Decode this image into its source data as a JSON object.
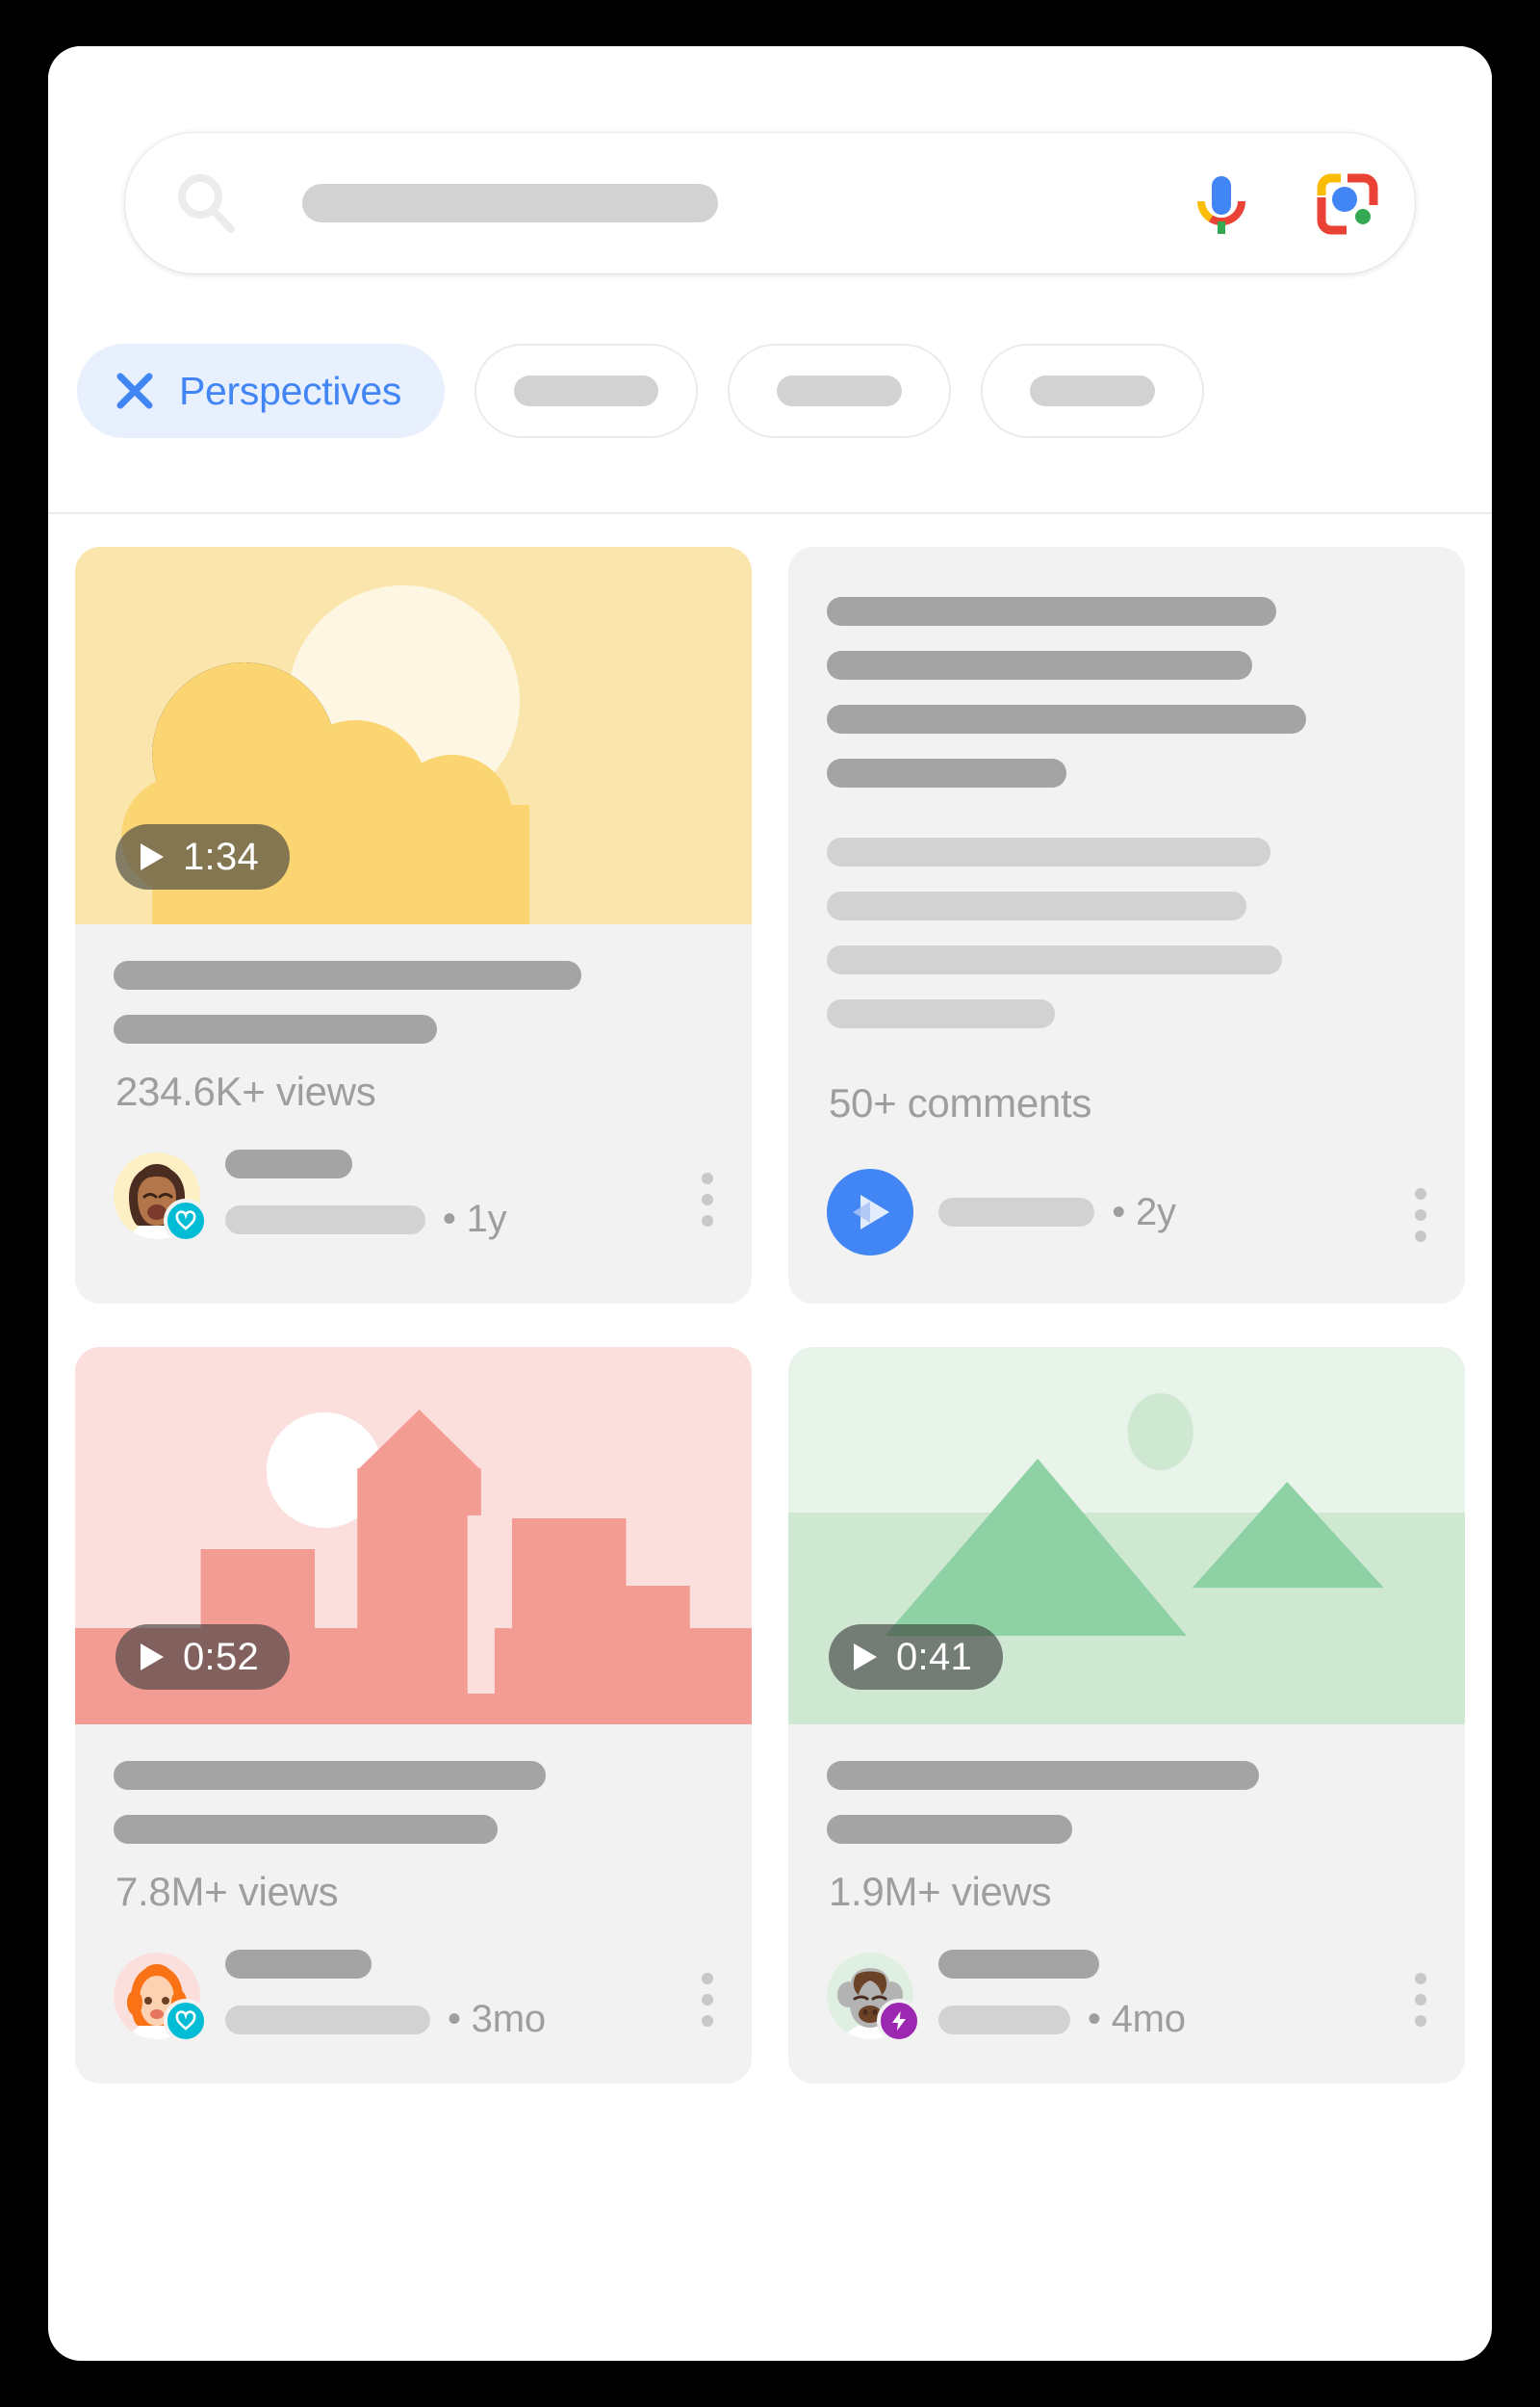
{
  "search": {
    "placeholder_visible": false,
    "icons": {
      "search": "search-icon",
      "mic": "microphone-icon",
      "lens": "google-lens-icon"
    }
  },
  "filters": {
    "chips": [
      {
        "label": "Perspectives",
        "active": true,
        "icon": "close-x-icon"
      },
      {
        "label": "",
        "active": false
      },
      {
        "label": "",
        "active": false
      },
      {
        "label": "",
        "active": false
      }
    ]
  },
  "results": [
    {
      "type": "video",
      "thumbnail": "sun-cloud-illustration",
      "duration": "1:34",
      "stat": "234.6K+ views",
      "age": "• 1y",
      "avatar": "woman-emoji-avatar",
      "badge": "heart-verified-badge",
      "badge_color": "#00bcd4"
    },
    {
      "type": "text",
      "thumbnail": "",
      "duration": "",
      "stat": "50+ comments",
      "age": "• 2y",
      "avatar": "blue-play-avatar",
      "badge": "",
      "badge_color": ""
    },
    {
      "type": "video",
      "thumbnail": "city-skyline-illustration",
      "duration": "0:52",
      "stat": "7.8M+ views",
      "age": "• 3mo",
      "avatar": "redhead-woman-emoji-avatar",
      "badge": "heart-verified-badge",
      "badge_color": "#00bcd4"
    },
    {
      "type": "video",
      "thumbnail": "mountains-illustration",
      "duration": "0:41",
      "stat": "1.9M+ views",
      "age": "• 4mo",
      "avatar": "bison-emoji-avatar",
      "badge": "lightning-bolt-badge",
      "badge_color": "#9c27b0"
    }
  ],
  "colors": {
    "accent_blue": "#4285f4",
    "chip_active_bg": "#e8f0fe",
    "card_bg": "#f2f2f2",
    "placeholder_dark": "#a4a4a4",
    "placeholder_light": "#d2d2d2",
    "meta_text": "#9e9e9e"
  }
}
